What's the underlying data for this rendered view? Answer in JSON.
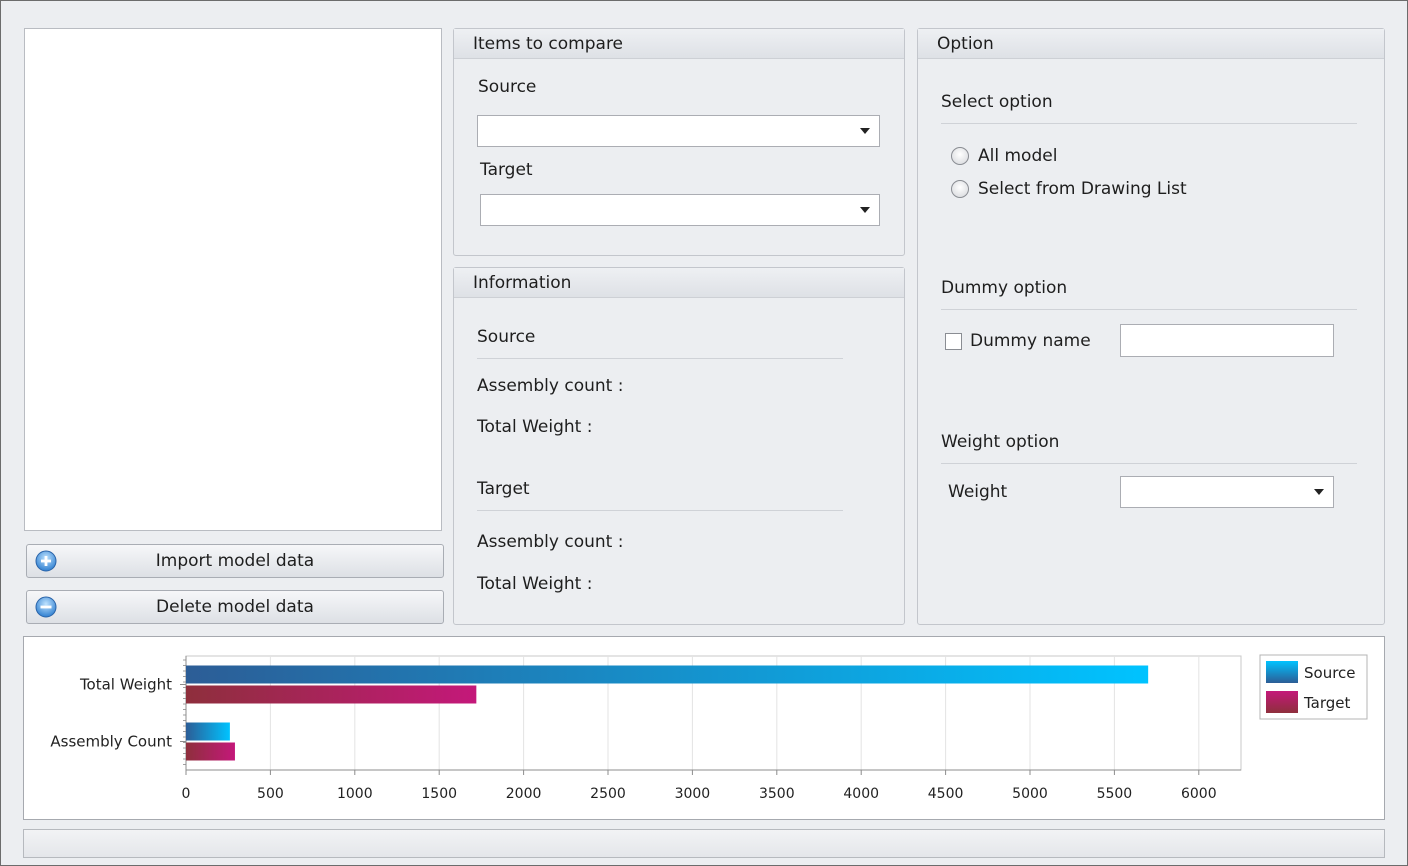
{
  "left_panel": {
    "import_button": "Import model data",
    "delete_button": "Delete model data"
  },
  "items_to_compare": {
    "title": "Items to compare",
    "source_label": "Source",
    "source_value": "",
    "target_label": "Target",
    "target_value": ""
  },
  "information": {
    "title": "Information",
    "source_heading": "Source",
    "source_assembly_count_label": "Assembly count :",
    "source_total_weight_label": "Total Weight :",
    "target_heading": "Target",
    "target_assembly_count_label": "Assembly count :",
    "target_total_weight_label": "Total Weight :"
  },
  "option": {
    "title": "Option",
    "select_option_heading": "Select option",
    "radio_all_model": "All model",
    "radio_drawing_list": "Select from Drawing List",
    "dummy_option_heading": "Dummy option",
    "dummy_name_label": "Dummy name",
    "dummy_name_value": "",
    "weight_option_heading": "Weight option",
    "weight_label": "Weight",
    "weight_value": ""
  },
  "colors": {
    "source_start": "#2c5d96",
    "source_end": "#00c3ff",
    "target_start": "#8e2f3c",
    "target_end": "#c4187a"
  },
  "chart_data": {
    "type": "bar",
    "orientation": "horizontal",
    "categories": [
      "Total Weight",
      "Assembly Count"
    ],
    "series": [
      {
        "name": "Source",
        "values": [
          5700,
          260
        ]
      },
      {
        "name": "Target",
        "values": [
          1720,
          290
        ]
      }
    ],
    "xlim": [
      0,
      6250
    ],
    "xticks": [
      0,
      500,
      1000,
      1500,
      2000,
      2500,
      3000,
      3500,
      4000,
      4500,
      5000,
      5500,
      6000
    ],
    "grid": true,
    "legend": "right"
  }
}
